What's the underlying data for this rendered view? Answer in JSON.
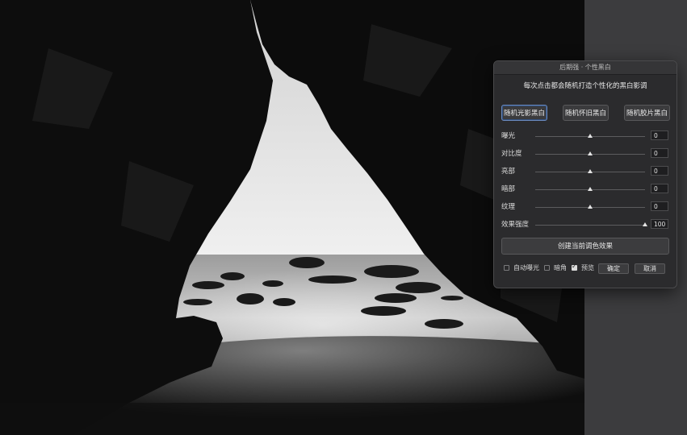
{
  "dialog": {
    "title": "后期强 · 个性黑白",
    "subtitle": "每次点击都会随机打造个性化的黑白影调",
    "presets": [
      {
        "label": "随机光影黑白",
        "active": true
      },
      {
        "label": "随机怀旧黑白",
        "active": false
      },
      {
        "label": "随机胶片黑白",
        "active": false
      }
    ],
    "sliders": [
      {
        "label": "曝光",
        "value": "0",
        "level": 0.5
      },
      {
        "label": "对比度",
        "value": "0",
        "level": 0.5
      },
      {
        "label": "亮部",
        "value": "0",
        "level": 0.5
      },
      {
        "label": "暗部",
        "value": "0",
        "level": 0.5
      },
      {
        "label": "纹理",
        "value": "0",
        "level": 0.5
      },
      {
        "label": "效果强度",
        "value": "100",
        "level": 1.0
      }
    ],
    "create_label": "创建当前调色效果",
    "options": {
      "auto_exposure": {
        "label": "自动曝光",
        "checked": false
      },
      "vignette": {
        "label": "暗角",
        "checked": false
      },
      "preview": {
        "label": "预览",
        "checked": true
      }
    },
    "ok_label": "确定",
    "cancel_label": "取消"
  },
  "colors": {
    "dialog_bg": "#2b2b2d",
    "active_border": "#6c8bbf"
  }
}
